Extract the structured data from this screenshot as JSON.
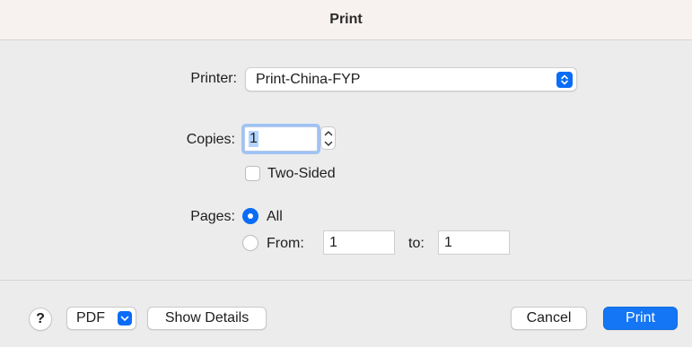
{
  "window": {
    "title": "Print"
  },
  "printer": {
    "label": "Printer:",
    "value": "Print-China-FYP"
  },
  "copies": {
    "label": "Copies:",
    "value": "1"
  },
  "two_sided": {
    "label": "Two-Sided",
    "checked": false
  },
  "pages": {
    "label": "Pages:",
    "all_label": "All",
    "from_label": "From:",
    "to_label": "to:",
    "from_value": "1",
    "to_value": "1",
    "selected": "All"
  },
  "footer": {
    "help_label": "?",
    "pdf_label": "PDF",
    "show_details_label": "Show Details",
    "cancel_label": "Cancel",
    "print_label": "Print"
  },
  "colors": {
    "accent": "#0a6cf7",
    "background": "#ececec",
    "titlebar": "#f7f2f0"
  },
  "icons": {
    "printer_popup": "up-down-chevron-icon",
    "copies_stepper": "stepper-icon",
    "pdf_menu": "chevron-down-icon"
  }
}
